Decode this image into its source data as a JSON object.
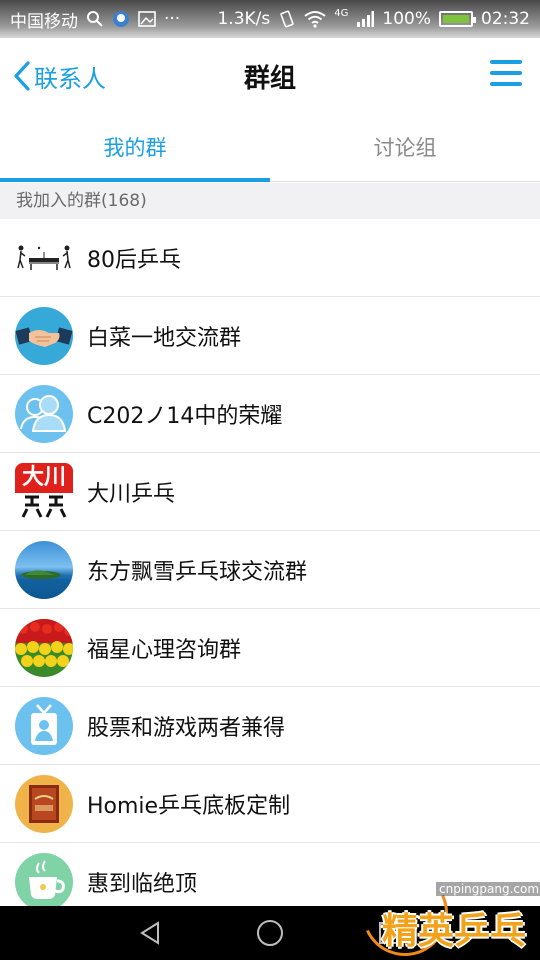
{
  "status_bar": {
    "carrier": "中国移动",
    "speed": "1.3K/s",
    "network": "4G",
    "battery": "100%",
    "time": "02:32",
    "battery_color": "#7ec23f"
  },
  "header": {
    "back_label": "联系人",
    "title": "群组",
    "accent": "#1aa0e2"
  },
  "tabs": [
    {
      "label": "我的群",
      "active": true
    },
    {
      "label": "讨论组",
      "active": false
    }
  ],
  "section": {
    "title": "我加入的群(168)"
  },
  "groups": [
    {
      "name": "80后乒乓",
      "avatar": "table-tennis-players-icon"
    },
    {
      "name": "白菜一地交流群",
      "avatar": "handshake-icon"
    },
    {
      "name": "C202ノ14中的荣耀",
      "avatar": "default-group-icon"
    },
    {
      "name": "大川乒乓",
      "avatar": "red-text-logo",
      "avatar_text": "大川"
    },
    {
      "name": "东方飘雪乒乓球交流群",
      "avatar": "island-sea-photo"
    },
    {
      "name": "福星心理咨询群",
      "avatar": "tulip-field-photo"
    },
    {
      "name": "股票和游戏两者兼得",
      "avatar": "id-badge-icon"
    },
    {
      "name": "Homie乒乓底板定制",
      "avatar": "blade-product-photo"
    },
    {
      "name": "惠到临绝顶",
      "avatar": "coffee-cup-icon"
    }
  ],
  "watermark": {
    "url": "cnpingpang.com",
    "text": "精英乒乓网"
  }
}
